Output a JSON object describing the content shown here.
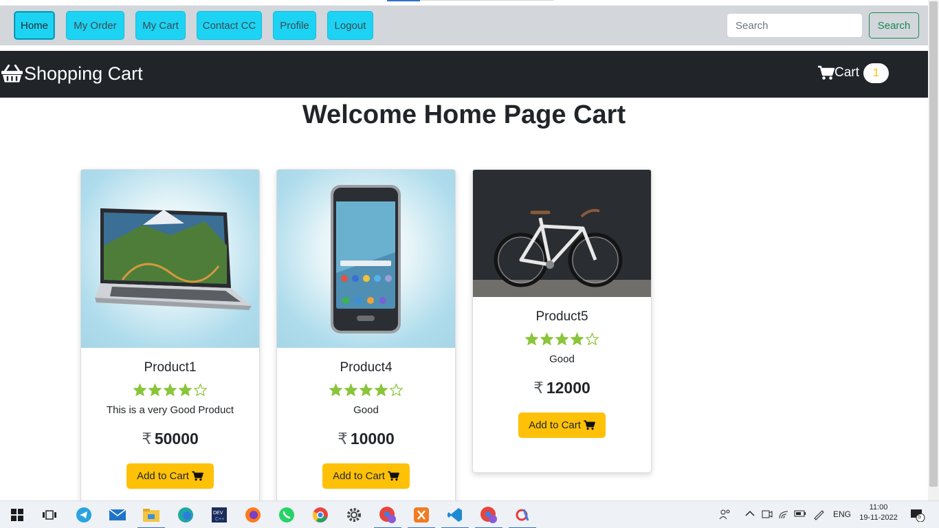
{
  "nav": {
    "items": [
      {
        "label": "Home",
        "active": true
      },
      {
        "label": "My Order"
      },
      {
        "label": "My Cart"
      },
      {
        "label": "Contact CC"
      },
      {
        "label": "Profile"
      },
      {
        "label": "Logout"
      }
    ],
    "search_placeholder": "Search",
    "search_button": "Search"
  },
  "brand": {
    "title": "Shopping Cart",
    "icon": "basket-icon"
  },
  "cart": {
    "label": "Cart",
    "count": "1",
    "icon": "shopping-cart-icon"
  },
  "page": {
    "heading": "Welcome Home Page Cart"
  },
  "products": [
    {
      "title": "Product1",
      "rating": 4,
      "max_rating": 5,
      "description": "This is a very Good Product",
      "currency": "₹",
      "price": "50000",
      "button": "Add to Cart",
      "image": "laptop-image"
    },
    {
      "title": "Product4",
      "rating": 4,
      "max_rating": 5,
      "description": "Good",
      "currency": "₹",
      "price": "10000",
      "button": "Add to Cart",
      "image": "smartphone-image"
    },
    {
      "title": "Product5",
      "rating": 4,
      "max_rating": 5,
      "description": "Good",
      "currency": "₹",
      "price": "12000",
      "button": "Add to Cart",
      "image": "bicycle-image"
    }
  ],
  "colors": {
    "nav_button": "#1dd3f3",
    "dark_bar": "#212529",
    "add_button": "#ffc107",
    "star": "#8ac53b",
    "search_outline": "#198754"
  },
  "taskbar": {
    "apps": [
      "windows-start-icon",
      "task-view-icon",
      "telegram-icon",
      "mail-icon",
      "file-explorer-icon",
      "edge-icon",
      "devc-icon",
      "firefox-icon",
      "whatsapp-icon",
      "chrome-icon",
      "settings-icon",
      "chrome-profile-icon",
      "xampp-icon",
      "vscode-icon",
      "chrome-profile-2-icon",
      "paint-icon"
    ],
    "language": "ENG",
    "time": "11:00",
    "date": "19-11-2022",
    "notifications": "5"
  }
}
